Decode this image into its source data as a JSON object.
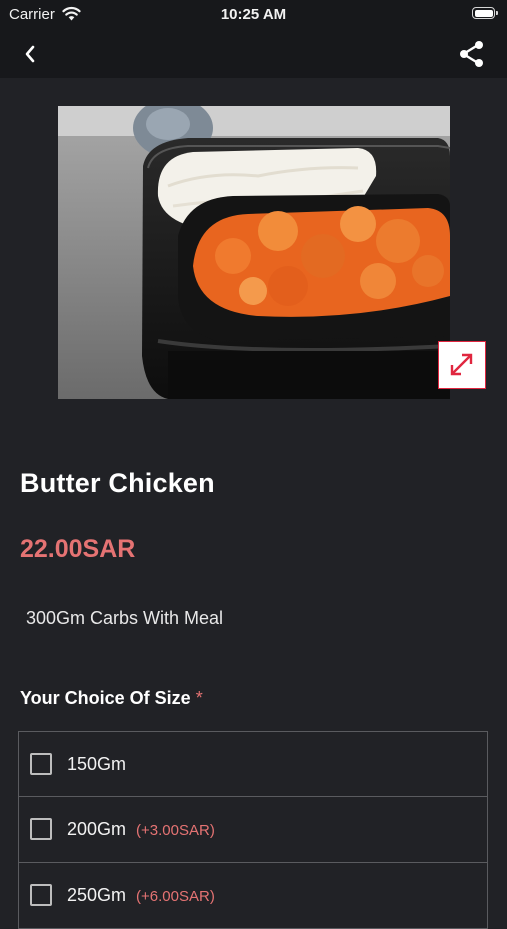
{
  "status_bar": {
    "carrier": "Carrier",
    "time": "10:25 AM",
    "icons": [
      "wifi-icon",
      "battery-icon"
    ]
  },
  "nav": {
    "back_icon": "chevron-left-icon",
    "share_icon": "share-icon"
  },
  "product": {
    "name": "Butter Chicken",
    "price": "22.00SAR",
    "description": "300Gm Carbs With Meal",
    "expand_icon": "expand-arrows-icon"
  },
  "choice_section": {
    "title": "Your Choice Of Size",
    "required_marker": "*",
    "options": [
      {
        "label": "150Gm",
        "extra": ""
      },
      {
        "label": "200Gm",
        "extra": "(+3.00SAR)"
      },
      {
        "label": "250Gm",
        "extra": "(+6.00SAR)"
      }
    ]
  },
  "colors": {
    "background": "#212226",
    "bar": "#17181b",
    "accent_price": "#e57373",
    "expand_border": "#e0263f"
  }
}
